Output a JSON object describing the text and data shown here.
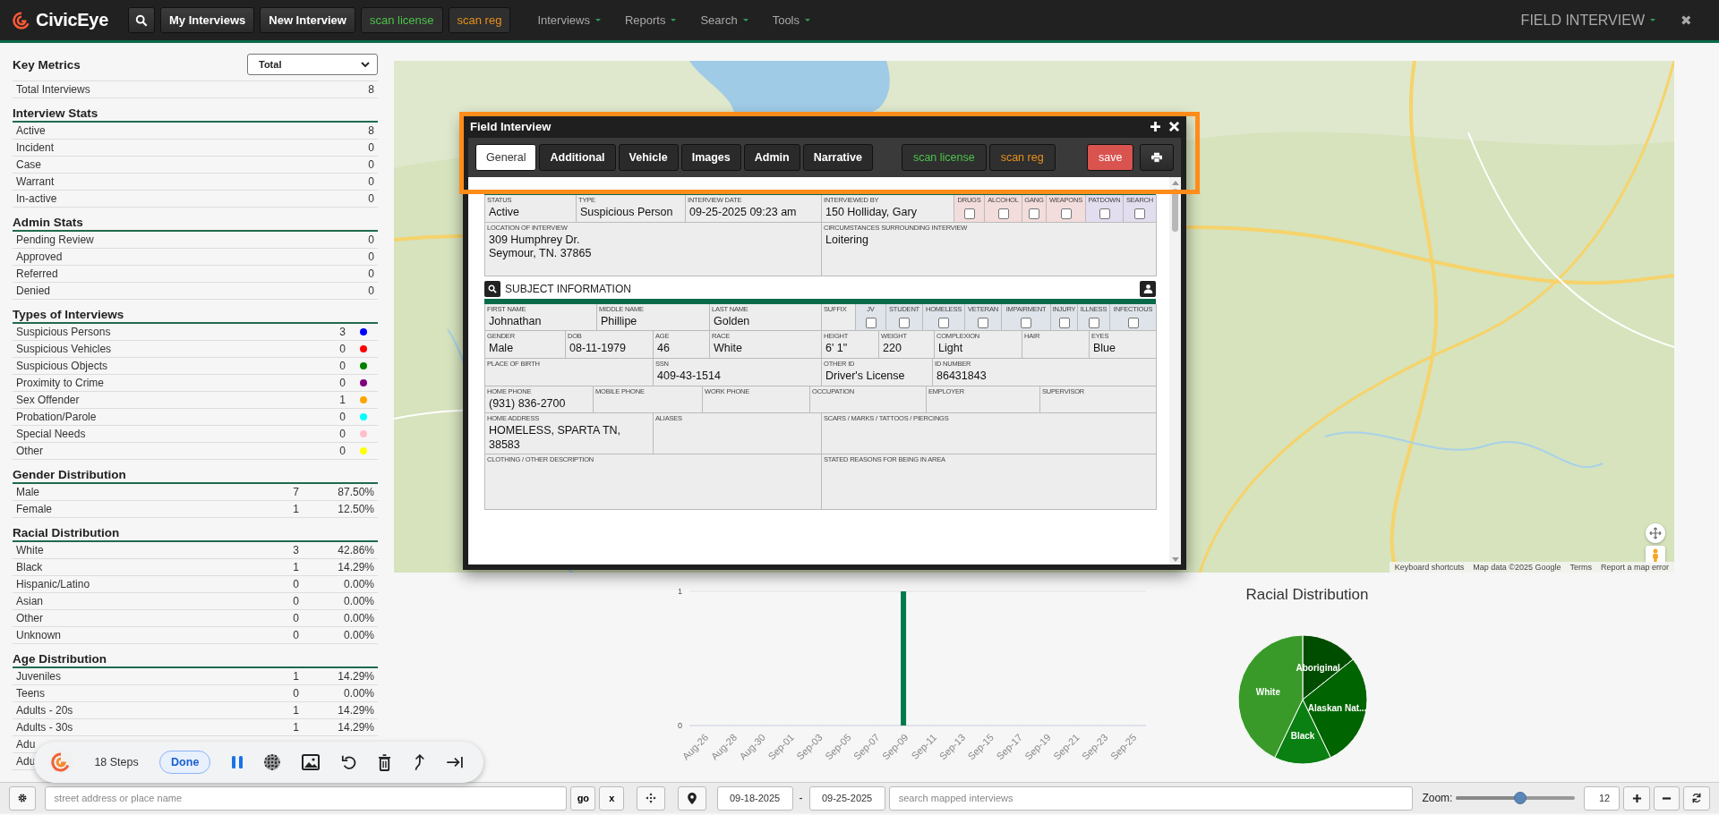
{
  "topbar": {
    "brand": "CivicEye",
    "buttons": [
      {
        "label": "My Interviews",
        "kind": "plain"
      },
      {
        "label": "New Interview",
        "kind": "plain"
      },
      {
        "label": "scan license",
        "kind": "green"
      },
      {
        "label": "scan reg",
        "kind": "orange"
      }
    ],
    "menus": [
      "Interviews",
      "Reports",
      "Search",
      "Tools"
    ],
    "module": "FIELD INTERVIEW",
    "close": "✖"
  },
  "metrics": {
    "title": "Key Metrics",
    "filter": "Total",
    "rows": [
      {
        "label": "Total Interviews",
        "count": "8"
      }
    ]
  },
  "sections": [
    {
      "title": "Interview Stats",
      "rows": [
        {
          "label": "Active",
          "count": "8"
        },
        {
          "label": "Incident",
          "count": "0"
        },
        {
          "label": "Case",
          "count": "0"
        },
        {
          "label": "Warrant",
          "count": "0"
        },
        {
          "label": "In-active",
          "count": "0"
        }
      ]
    },
    {
      "title": "Admin Stats",
      "rows": [
        {
          "label": "Pending Review",
          "count": "0"
        },
        {
          "label": "Approved",
          "count": "0"
        },
        {
          "label": "Referred",
          "count": "0"
        },
        {
          "label": "Denied",
          "count": "0"
        }
      ]
    },
    {
      "title": "Types of Interviews",
      "rows": [
        {
          "label": "Suspicious Persons",
          "count": "3",
          "color": "#0000ff"
        },
        {
          "label": "Suspicious Vehicles",
          "count": "0",
          "color": "#ff0000"
        },
        {
          "label": "Suspicious Objects",
          "count": "0",
          "color": "#008000"
        },
        {
          "label": "Proximity to Crime",
          "count": "0",
          "color": "#800080"
        },
        {
          "label": "Sex Offender",
          "count": "1",
          "color": "#ffa500"
        },
        {
          "label": "Probation/Parole",
          "count": "0",
          "color": "#00ffff"
        },
        {
          "label": "Special Needs",
          "count": "0",
          "color": "#ffc0cb"
        },
        {
          "label": "Other",
          "count": "0",
          "color": "#ffff00"
        }
      ]
    },
    {
      "title": "Gender Distribution",
      "rows": [
        {
          "label": "Male",
          "count": "7",
          "percent": "87.50%"
        },
        {
          "label": "Female",
          "count": "1",
          "percent": "12.50%"
        }
      ]
    },
    {
      "title": "Racial Distribution",
      "rows": [
        {
          "label": "White",
          "count": "3",
          "percent": "42.86%"
        },
        {
          "label": "Black",
          "count": "1",
          "percent": "14.29%"
        },
        {
          "label": "Hispanic/Latino",
          "count": "0",
          "percent": "0.00%"
        },
        {
          "label": "Asian",
          "count": "0",
          "percent": "0.00%"
        },
        {
          "label": "Other",
          "count": "0",
          "percent": "0.00%"
        },
        {
          "label": "Unknown",
          "count": "0",
          "percent": "0.00%"
        }
      ]
    },
    {
      "title": "Age Distribution",
      "rows": [
        {
          "label": "Juveniles",
          "count": "1",
          "percent": "14.29%"
        },
        {
          "label": "Teens",
          "count": "0",
          "percent": "0.00%"
        },
        {
          "label": "Adults - 20s",
          "count": "1",
          "percent": "14.29%"
        },
        {
          "label": "Adults - 30s",
          "count": "1",
          "percent": "14.29%"
        },
        {
          "label": "Adu"
        },
        {
          "label": "Adu"
        }
      ]
    }
  ],
  "map": {
    "kind": "picture",
    "attribution": [
      "Keyboard shortcuts",
      "Map data ©2025 Google",
      "Terms",
      "Report a map error"
    ]
  },
  "modal": {
    "title": "Field Interview",
    "tabs": [
      {
        "label": "General",
        "selected": true
      },
      {
        "label": "Additional",
        "selected": false
      },
      {
        "label": "Vehicle",
        "selected": false
      },
      {
        "label": "Images",
        "selected": false
      },
      {
        "label": "Admin",
        "selected": false
      },
      {
        "label": "Narrative",
        "selected": false
      }
    ],
    "actions": [
      {
        "label": "scan license",
        "kind": "green"
      },
      {
        "label": "scan reg",
        "kind": "orange"
      },
      {
        "label": "save",
        "kind": "danger"
      }
    ],
    "status_row": {
      "cells": [
        {
          "kind": "field",
          "label": "STATUS",
          "value": "Active"
        },
        {
          "kind": "field",
          "label": "TYPE",
          "value": "Suspicious Person"
        },
        {
          "kind": "field",
          "label": "INTERVIEW DATE",
          "value": "09-25-2025 09:23 am"
        },
        {
          "kind": "field",
          "label": "INTERVIEWED BY",
          "value": "150 Holliday, Gary"
        },
        {
          "kind": "check",
          "label": "DRUGS",
          "checked": false,
          "color": "#f3dcdc"
        },
        {
          "kind": "check",
          "label": "ALCOHOL",
          "checked": false,
          "color": "#f3dcdc"
        },
        {
          "kind": "check",
          "label": "GANG",
          "checked": false,
          "color": "#f3dcdc"
        },
        {
          "kind": "check",
          "label": "WEAPONS",
          "checked": false,
          "color": "#f3dcdc"
        },
        {
          "kind": "check",
          "label": "PATDOWN",
          "checked": false,
          "color": "#e2ddef"
        },
        {
          "kind": "check",
          "label": "SEARCH",
          "checked": false,
          "color": "#e2ddef"
        }
      ]
    },
    "location_row": {
      "cells": [
        {
          "kind": "field",
          "label": "LOCATION OF INTERVIEW",
          "value": "309 Humphrey Dr.\nSeymour, TN. 37865"
        },
        {
          "kind": "field",
          "label": "CIRCUMSTANCES SURROUNDING INTERVIEW",
          "value": "Loitering"
        }
      ]
    },
    "subject_title": "SUBJECT INFORMATION",
    "name_row": {
      "cells": [
        {
          "kind": "field",
          "label": "FIRST NAME",
          "value": "Johnathan"
        },
        {
          "kind": "field",
          "label": "MIDDLE NAME",
          "value": "Phillipe"
        },
        {
          "kind": "field",
          "label": "LAST NAME",
          "value": "Golden"
        },
        {
          "kind": "field",
          "label": "SUFFIX"
        },
        {
          "kind": "check",
          "label": "JV",
          "checked": false,
          "color": "#dfe3ea"
        },
        {
          "kind": "check",
          "label": "STUDENT",
          "checked": false,
          "color": "#dfe3ea"
        },
        {
          "kind": "check",
          "label": "HOMELESS",
          "checked": false,
          "color": "#dfe3ea"
        },
        {
          "kind": "check",
          "label": "VETERAN",
          "checked": false,
          "color": "#dfe3ea"
        },
        {
          "kind": "check",
          "label": "IMPAIRMENT",
          "checked": false,
          "color": "#dfe3ea"
        },
        {
          "kind": "check",
          "label": "INJURY",
          "checked": false,
          "color": "#dfe3ea"
        },
        {
          "kind": "check",
          "label": "ILLNESS",
          "checked": false,
          "color": "#dfe3ea"
        },
        {
          "kind": "check",
          "label": "INFECTIOUS",
          "checked": false,
          "color": "#dfe3ea"
        }
      ]
    },
    "physical_row": {
      "cells": [
        {
          "kind": "field",
          "label": "GENDER",
          "value": "Male"
        },
        {
          "kind": "field",
          "label": "DOB",
          "value": "08-11-1979"
        },
        {
          "kind": "field",
          "label": "AGE",
          "value": "46"
        },
        {
          "kind": "field",
          "label": "RACE",
          "value": "White"
        },
        {
          "kind": "field",
          "label": "HEIGHT",
          "value": "6' 1\""
        },
        {
          "kind": "field",
          "label": "WEIGHT",
          "value": "220"
        },
        {
          "kind": "field",
          "label": "COMPLEXION",
          "value": "Light"
        },
        {
          "kind": "field",
          "label": "HAIR"
        },
        {
          "kind": "field",
          "label": "EYES",
          "value": "Blue"
        }
      ]
    },
    "id_row": {
      "cells": [
        {
          "kind": "field",
          "label": "PLACE OF BIRTH"
        },
        {
          "kind": "field",
          "label": "SSN",
          "value": "409-43-1514"
        },
        {
          "kind": "field",
          "label": "OTHER ID",
          "value": "Driver's License"
        },
        {
          "kind": "field",
          "label": "ID NUMBER",
          "value": "86431843"
        }
      ]
    },
    "phone_row": {
      "cells": [
        {
          "kind": "field",
          "label": "HOME PHONE",
          "value": "(931) 836-2700"
        },
        {
          "kind": "field",
          "label": "MOBILE PHONE"
        },
        {
          "kind": "field",
          "label": "WORK PHONE"
        },
        {
          "kind": "field",
          "label": "OCCUPATION"
        },
        {
          "kind": "field",
          "label": "EMPLOYER"
        },
        {
          "kind": "field",
          "label": "SUPERVISOR"
        }
      ]
    },
    "address_row": {
      "cells": [
        {
          "kind": "field",
          "label": "HOME ADDRESS",
          "value": "HOMELESS, SPARTA TN, 38583"
        },
        {
          "kind": "field",
          "label": "ALIASES"
        },
        {
          "kind": "field",
          "label": "SCARS / MARKS / TATTOOS / PIERCINGS"
        }
      ]
    },
    "description_row": {
      "cells": [
        {
          "kind": "field",
          "label": "CLOTHING / OTHER DESCRIPTION"
        },
        {
          "kind": "field",
          "label": "STATED REASONS FOR BEING IN AREA"
        }
      ]
    }
  },
  "bar_chart": {
    "chart_data": {
      "type": "bar",
      "categories": [
        "Aug-26",
        "Aug-28",
        "Aug-30",
        "Sep-01",
        "Sep-03",
        "Sep-05",
        "Sep-07",
        "Sep-09",
        "Sep-11",
        "Sep-13",
        "Sep-15",
        "Sep-17",
        "Sep-19",
        "Sep-21",
        "Sep-23",
        "Sep-25"
      ],
      "series": [
        {
          "color": "#007a4d",
          "values": [
            0,
            0,
            0,
            0,
            0,
            0,
            0,
            1,
            0,
            0,
            0,
            0,
            0,
            0,
            0,
            0
          ]
        }
      ],
      "ylim": [
        0,
        1
      ],
      "yticks": [
        0,
        1
      ]
    }
  },
  "pie_chart": {
    "chart_data": {
      "type": "pie",
      "title": "Racial Distribution",
      "categories": [
        "Aboriginal",
        "Alaskan Nat...",
        "Black",
        "White"
      ],
      "colors": [
        "#004d00",
        "#006400",
        "#0b8012",
        "#399a29"
      ],
      "series": [
        {
          "values": [
            14.28,
            28.57,
            14.29,
            42.86
          ]
        }
      ]
    }
  },
  "recorder": {
    "steps": "18 Steps",
    "done": "Done"
  },
  "bottombar": {
    "address_placeholder": "street address or place name",
    "go": "go",
    "clear": "x",
    "date_from": "09-18-2025",
    "date_sep": "-",
    "date_to": "09-25-2025",
    "search_placeholder": "search mapped interviews",
    "zoom_label": "Zoom:",
    "zoom": {
      "level": 0.54
    },
    "zoom_value": "12"
  }
}
